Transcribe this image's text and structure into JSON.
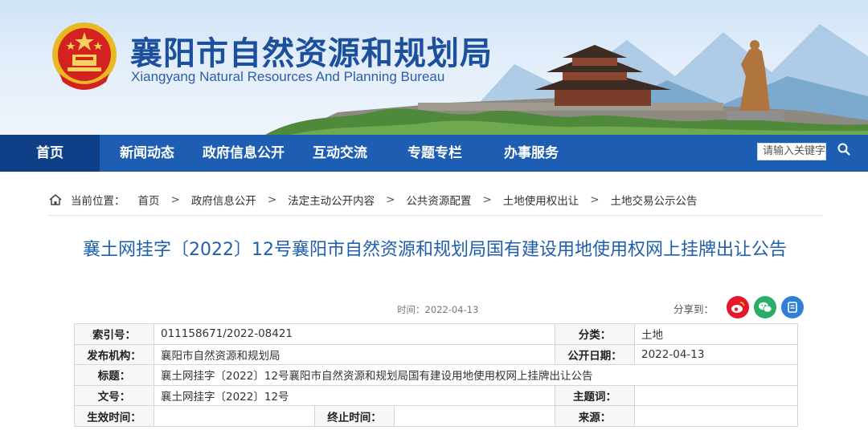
{
  "site": {
    "title": "襄阳市自然资源和规划局",
    "subtitle": "Xiangyang Natural Resources And Planning Bureau"
  },
  "nav": {
    "items": [
      {
        "label": "首页",
        "active": true
      },
      {
        "label": "新闻动态",
        "active": false
      },
      {
        "label": "政府信息公开",
        "active": false
      },
      {
        "label": "互动交流",
        "active": false
      },
      {
        "label": "专题专栏",
        "active": false
      },
      {
        "label": "办事服务",
        "active": false
      }
    ],
    "search_placeholder": "请输入关键字"
  },
  "breadcrumb": {
    "prefix": "当前位置：",
    "items": [
      "首页",
      "政府信息公开",
      "法定主动公开内容",
      "公共资源配置",
      "土地使用权出让",
      "土地交易公示公告"
    ],
    "separator": ">"
  },
  "article": {
    "title": "襄土网挂字〔2022〕12号襄阳市自然资源和规划局国有建设用地使用权网上挂牌出让公告",
    "time_label": "时间：",
    "time": "2022-04-13",
    "share_label": "分享到："
  },
  "info_table": {
    "index_no_label": "索引号：",
    "index_no": "011158671/2022-08421",
    "category_label": "分类：",
    "category": "土地",
    "publisher_label": "发布机构：",
    "publisher": "襄阳市自然资源和规划局",
    "publish_date_label": "公开日期：",
    "publish_date": "2022-04-13",
    "title_label": "标题：",
    "title": "襄土网挂字〔2022〕12号襄阳市自然资源和规划局国有建设用地使用权网上挂牌出让公告",
    "doc_no_label": "文号：",
    "doc_no": "襄土网挂字〔2022〕12号",
    "subject_label": "主题词：",
    "subject": "",
    "effective_label": "生效时间：",
    "effective": "",
    "end_label": "终止时间：",
    "end": "",
    "source_label": "来源：",
    "source": ""
  },
  "colors": {
    "nav_bg": "#1d5eb2",
    "nav_active": "#0f3f86",
    "title_blue": "#1f5fad",
    "weibo": "#e6162d",
    "wechat": "#2aae67",
    "share_blue": "#2f7fd6"
  },
  "icons": {
    "home": "home-icon",
    "search": "search-icon",
    "weibo": "weibo-icon",
    "wechat": "wechat-icon",
    "share": "share-icon"
  }
}
